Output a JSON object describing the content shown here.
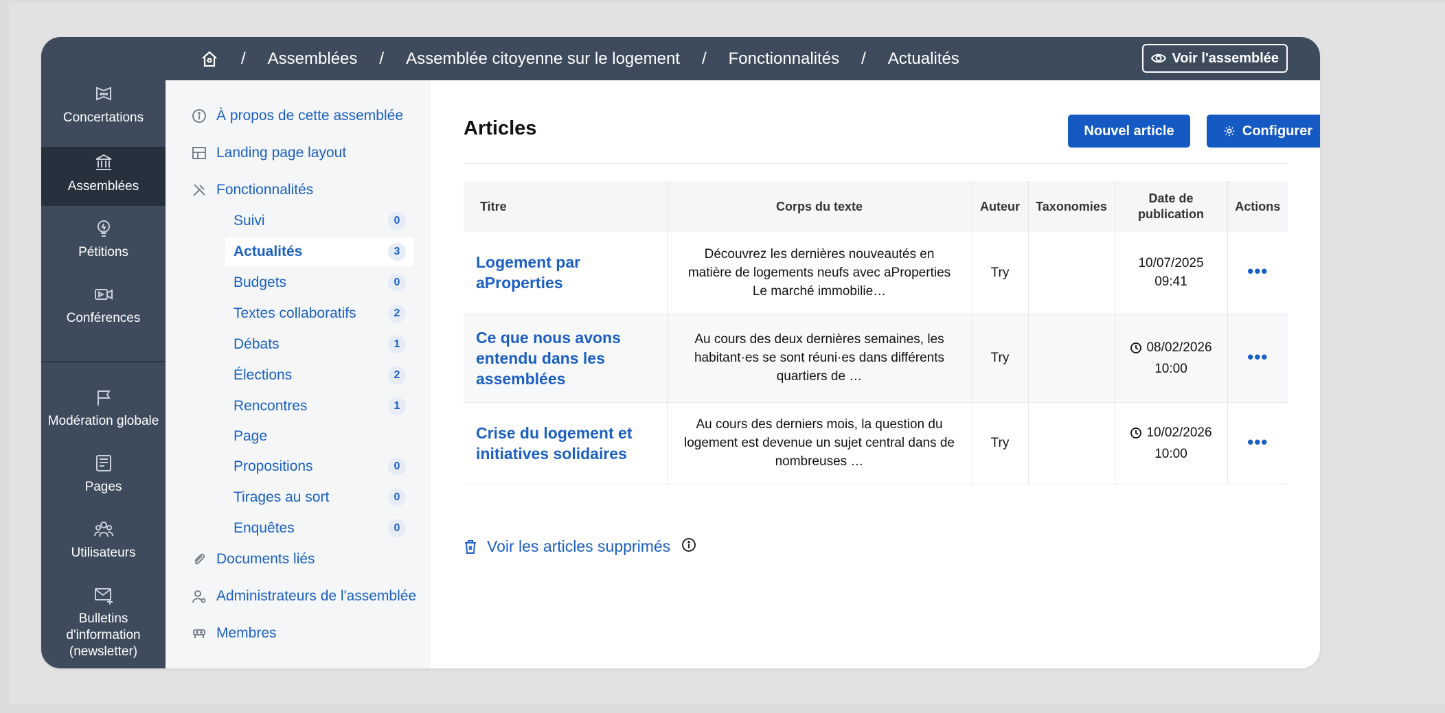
{
  "rail": {
    "items": [
      {
        "label": "Concertations",
        "icon": "concertation-icon"
      },
      {
        "label": "Assemblées",
        "icon": "assembly-icon"
      },
      {
        "label": "Pétitions",
        "icon": "petition-icon"
      },
      {
        "label": "Conférences",
        "icon": "conference-icon"
      },
      {
        "label": "Modération globale",
        "icon": "flag-icon"
      },
      {
        "label": "Pages",
        "icon": "page-icon"
      },
      {
        "label": "Utilisateurs",
        "icon": "users-icon"
      },
      {
        "label": "Bulletins d'information (newsletter)",
        "icon": "mail-plus-icon"
      }
    ]
  },
  "breadcrumb": {
    "items": [
      "Assemblées",
      "Assemblée citoyenne sur le logement",
      "Fonctionnalités",
      "Actualités"
    ],
    "separator": "/"
  },
  "header": {
    "view_label": "Voir l'assemblée"
  },
  "subnav": {
    "about": "À propos de cette assemblée",
    "landing": "Landing page layout",
    "features": "Fonctionnalités",
    "components": [
      {
        "label": "Suivi",
        "count": "0"
      },
      {
        "label": "Actualités",
        "count": "3"
      },
      {
        "label": "Budgets",
        "count": "0"
      },
      {
        "label": "Textes collaboratifs",
        "count": "2"
      },
      {
        "label": "Débats",
        "count": "1"
      },
      {
        "label": "Élections",
        "count": "2"
      },
      {
        "label": "Rencontres",
        "count": "1"
      },
      {
        "label": "Page",
        "count": ""
      },
      {
        "label": "Propositions",
        "count": "0"
      },
      {
        "label": "Tirages au sort",
        "count": "0"
      },
      {
        "label": "Enquêtes",
        "count": "0"
      }
    ],
    "documents": "Documents liés",
    "admins": "Administrateurs de l'assemblée",
    "members": "Membres"
  },
  "main": {
    "title": "Articles",
    "new_label": "Nouvel article",
    "configure_label": "Configurer",
    "columns": [
      "Titre",
      "Corps du texte",
      "Auteur",
      "Taxonomies",
      "Date de publication",
      "Actions"
    ],
    "rows": [
      {
        "title": "Logement par aProperties",
        "body": "Découvrez les dernières nouveautés en matière de logements neufs avec aProperties Le marché immobilie…",
        "author": "Try",
        "taxonomies": "",
        "date": "10/07/2025",
        "time": "09:41",
        "scheduled": false,
        "actions": "•••"
      },
      {
        "title": "Ce que nous avons entendu dans les assemblées",
        "body": "Au cours des deux dernières semaines, les habitant·es se sont réuni·es dans différents quartiers de …",
        "author": "Try",
        "taxonomies": "",
        "date": "08/02/2026",
        "time": "10:00",
        "scheduled": true,
        "actions": "•••"
      },
      {
        "title": "Crise du logement et initiatives solidaires",
        "body": "Au cours des derniers mois, la question du logement est devenue un sujet central dans de nombreuses …",
        "author": "Try",
        "taxonomies": "",
        "date": "10/02/2026",
        "time": "10:00",
        "scheduled": true,
        "actions": "•••"
      }
    ],
    "deleted_label": "Voir les articles supprimés"
  },
  "colors": {
    "rail": "#3e4b5c",
    "rail_active": "#26313d",
    "primary": "#1559c2",
    "link": "#1b5fc2",
    "subnav_bg": "#f4f6f8"
  }
}
